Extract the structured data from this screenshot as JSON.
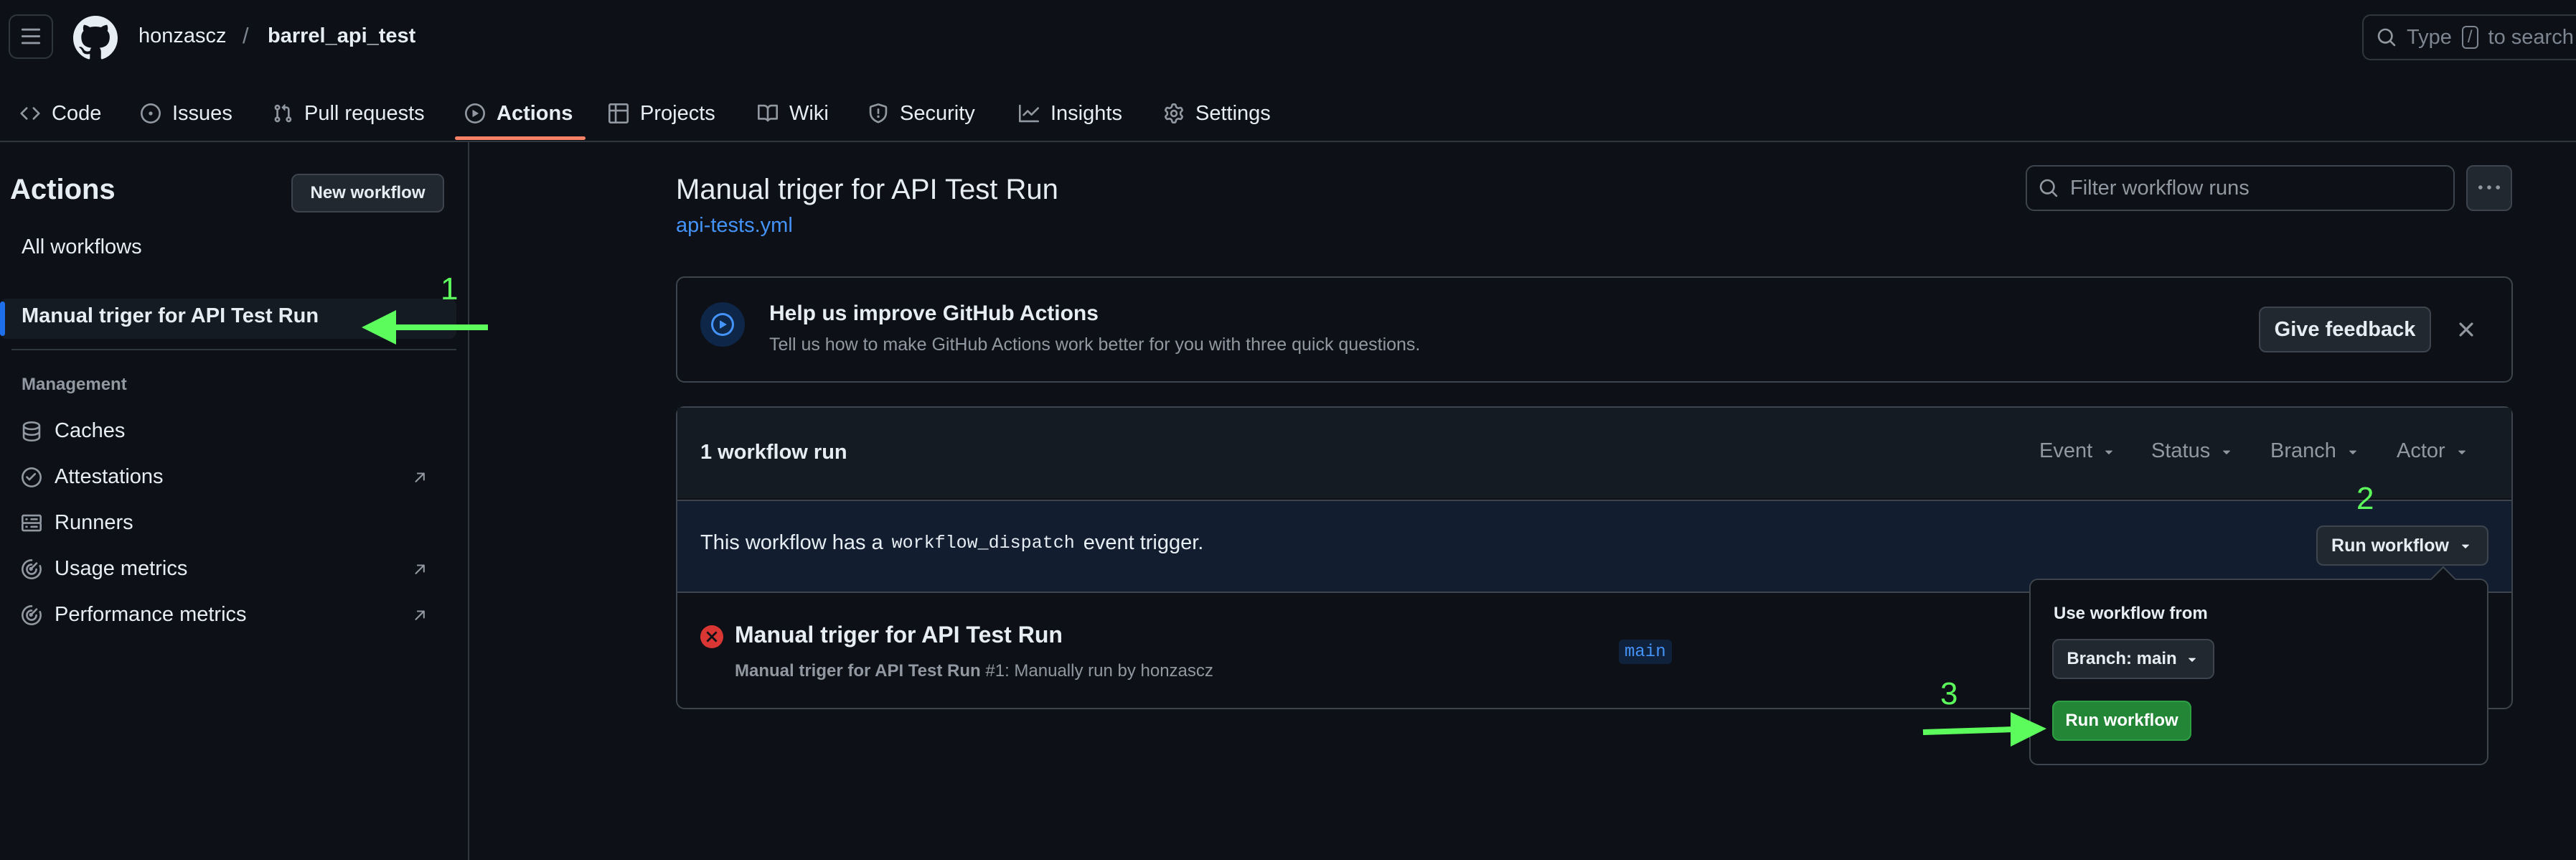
{
  "header": {
    "owner": "honzascz",
    "separator": "/",
    "repo": "barrel_api_test",
    "search_prefix": "Type",
    "search_key": "/",
    "search_suffix": "to search"
  },
  "nav": {
    "code": "Code",
    "issues": "Issues",
    "pull_requests": "Pull requests",
    "actions": "Actions",
    "projects": "Projects",
    "wiki": "Wiki",
    "security": "Security",
    "insights": "Insights",
    "settings": "Settings"
  },
  "sidebar": {
    "title": "Actions",
    "new_workflow": "New workflow",
    "all_workflows": "All workflows",
    "selected_workflow": "Manual triger for API Test Run",
    "management_heading": "Management",
    "management_items": [
      {
        "label": "Caches",
        "icon": "database-icon"
      },
      {
        "label": "Attestations",
        "icon": "verified-icon"
      },
      {
        "label": "Runners",
        "icon": "server-icon"
      },
      {
        "label": "Usage metrics",
        "icon": "meter-icon"
      },
      {
        "label": "Performance metrics",
        "icon": "meter-icon"
      }
    ]
  },
  "main": {
    "title": "Manual triger for API Test Run",
    "file": "api-tests.yml",
    "filter_placeholder": "Filter workflow runs",
    "banner": {
      "title": "Help us improve GitHub Actions",
      "subtitle": "Tell us how to make GitHub Actions work better for you with three quick questions.",
      "button": "Give feedback"
    },
    "runs": {
      "count_label": "1 workflow run",
      "filters": [
        "Event",
        "Status",
        "Branch",
        "Actor"
      ],
      "dispatch_prefix": "This workflow has a",
      "dispatch_code": "workflow_dispatch",
      "dispatch_suffix": "event trigger.",
      "run_workflow_button": "Run workflow",
      "items": [
        {
          "title": "Manual triger for API Test Run",
          "sub_bold": "Manual triger for API Test Run",
          "sub_rest": "#1: Manually run by honzascz",
          "branch": "main",
          "status": "failed"
        }
      ]
    }
  },
  "popover": {
    "title": "Use workflow from",
    "branch_button": "Branch: main",
    "run_button": "Run workflow"
  },
  "annotations": [
    "1",
    "2",
    "3"
  ],
  "colors": {
    "background": "#0d1117",
    "accent_blue": "#4493f8",
    "active_tab_underline": "#f78166",
    "run_button_green": "#238636",
    "fail_red": "#da3633",
    "annotation_green": "#5dfc5d"
  }
}
